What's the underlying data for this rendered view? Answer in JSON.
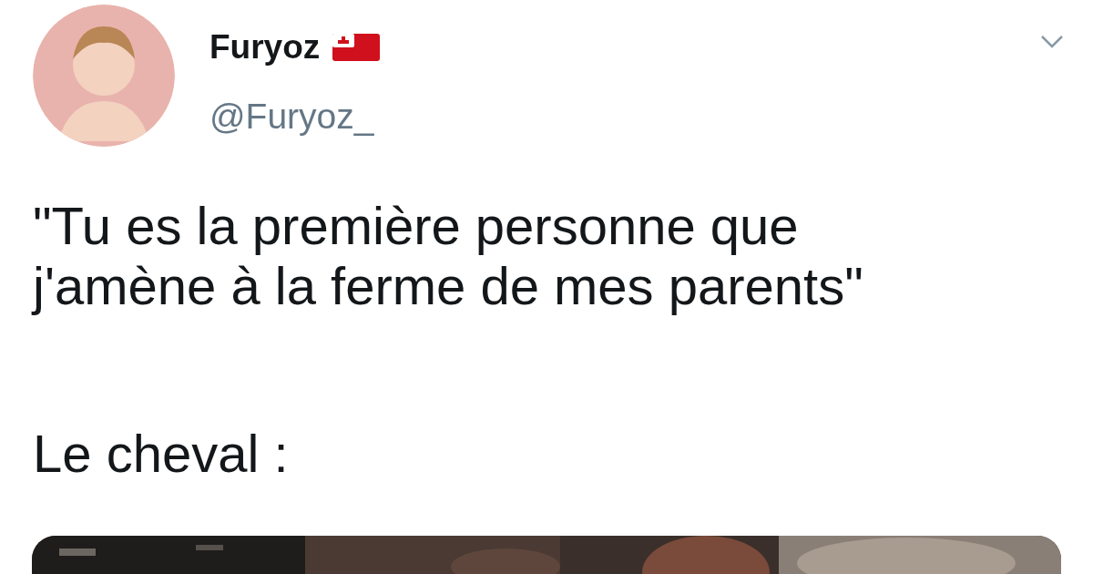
{
  "tweet": {
    "author": {
      "name": "Furyoz",
      "handle": "@Furyoz_"
    },
    "paragraphs": [
      "\"Tu es la première personne que\nj'amène à la ferme de mes parents\"",
      "Le cheval :"
    ]
  }
}
